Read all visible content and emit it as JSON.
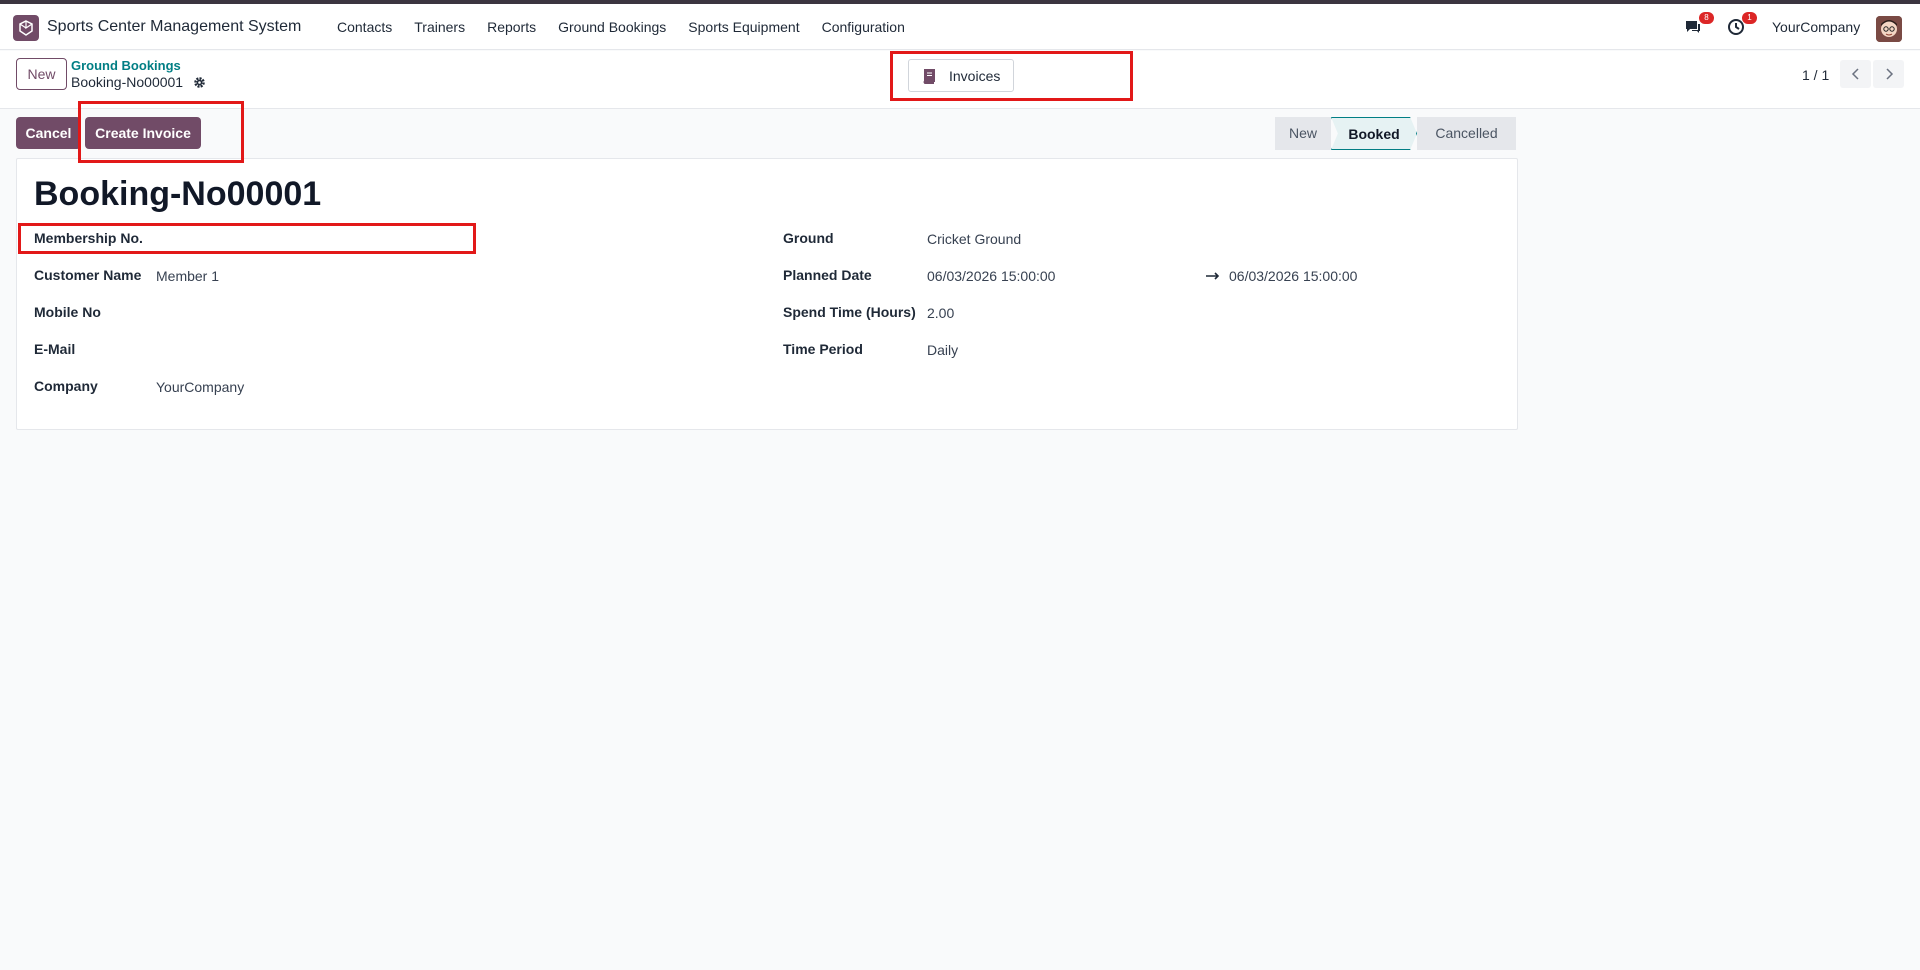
{
  "navbar": {
    "app_name": "Sports Center Management System",
    "menu": [
      "Contacts",
      "Trainers",
      "Reports",
      "Ground Bookings",
      "Sports Equipment",
      "Configuration"
    ],
    "messages_count": "8",
    "activity_count": "1",
    "company": "YourCompany"
  },
  "control": {
    "new_label": "New",
    "breadcrumb_parent": "Ground Bookings",
    "breadcrumb_current": "Booking-No00001",
    "invoices_label": "Invoices",
    "pager": "1 / 1"
  },
  "actions": {
    "cancel_label": "Cancel",
    "create_invoice_label": "Create Invoice"
  },
  "status": {
    "steps": [
      "New",
      "Booked",
      "Cancelled"
    ],
    "active": "Booked"
  },
  "form": {
    "title": "Booking-No00001",
    "left": [
      {
        "label": "Membership No.",
        "value": ""
      },
      {
        "label": "Customer Name",
        "value": "Member 1"
      },
      {
        "label": "Mobile No",
        "value": ""
      },
      {
        "label": "E-Mail",
        "value": ""
      },
      {
        "label": "Company",
        "value": "YourCompany"
      }
    ],
    "right": {
      "ground_label": "Ground",
      "ground_value": "Cricket Ground",
      "planned_label": "Planned Date",
      "planned_start": "06/03/2026 15:00:00",
      "planned_end": "06/03/2026 15:00:00",
      "spend_label": "Spend Time (Hours)",
      "spend_value": "2.00",
      "period_label": "Time Period",
      "period_value": "Daily"
    }
  },
  "colors": {
    "brand": "#714b67",
    "highlight": "#e21818",
    "link": "#017e84"
  }
}
